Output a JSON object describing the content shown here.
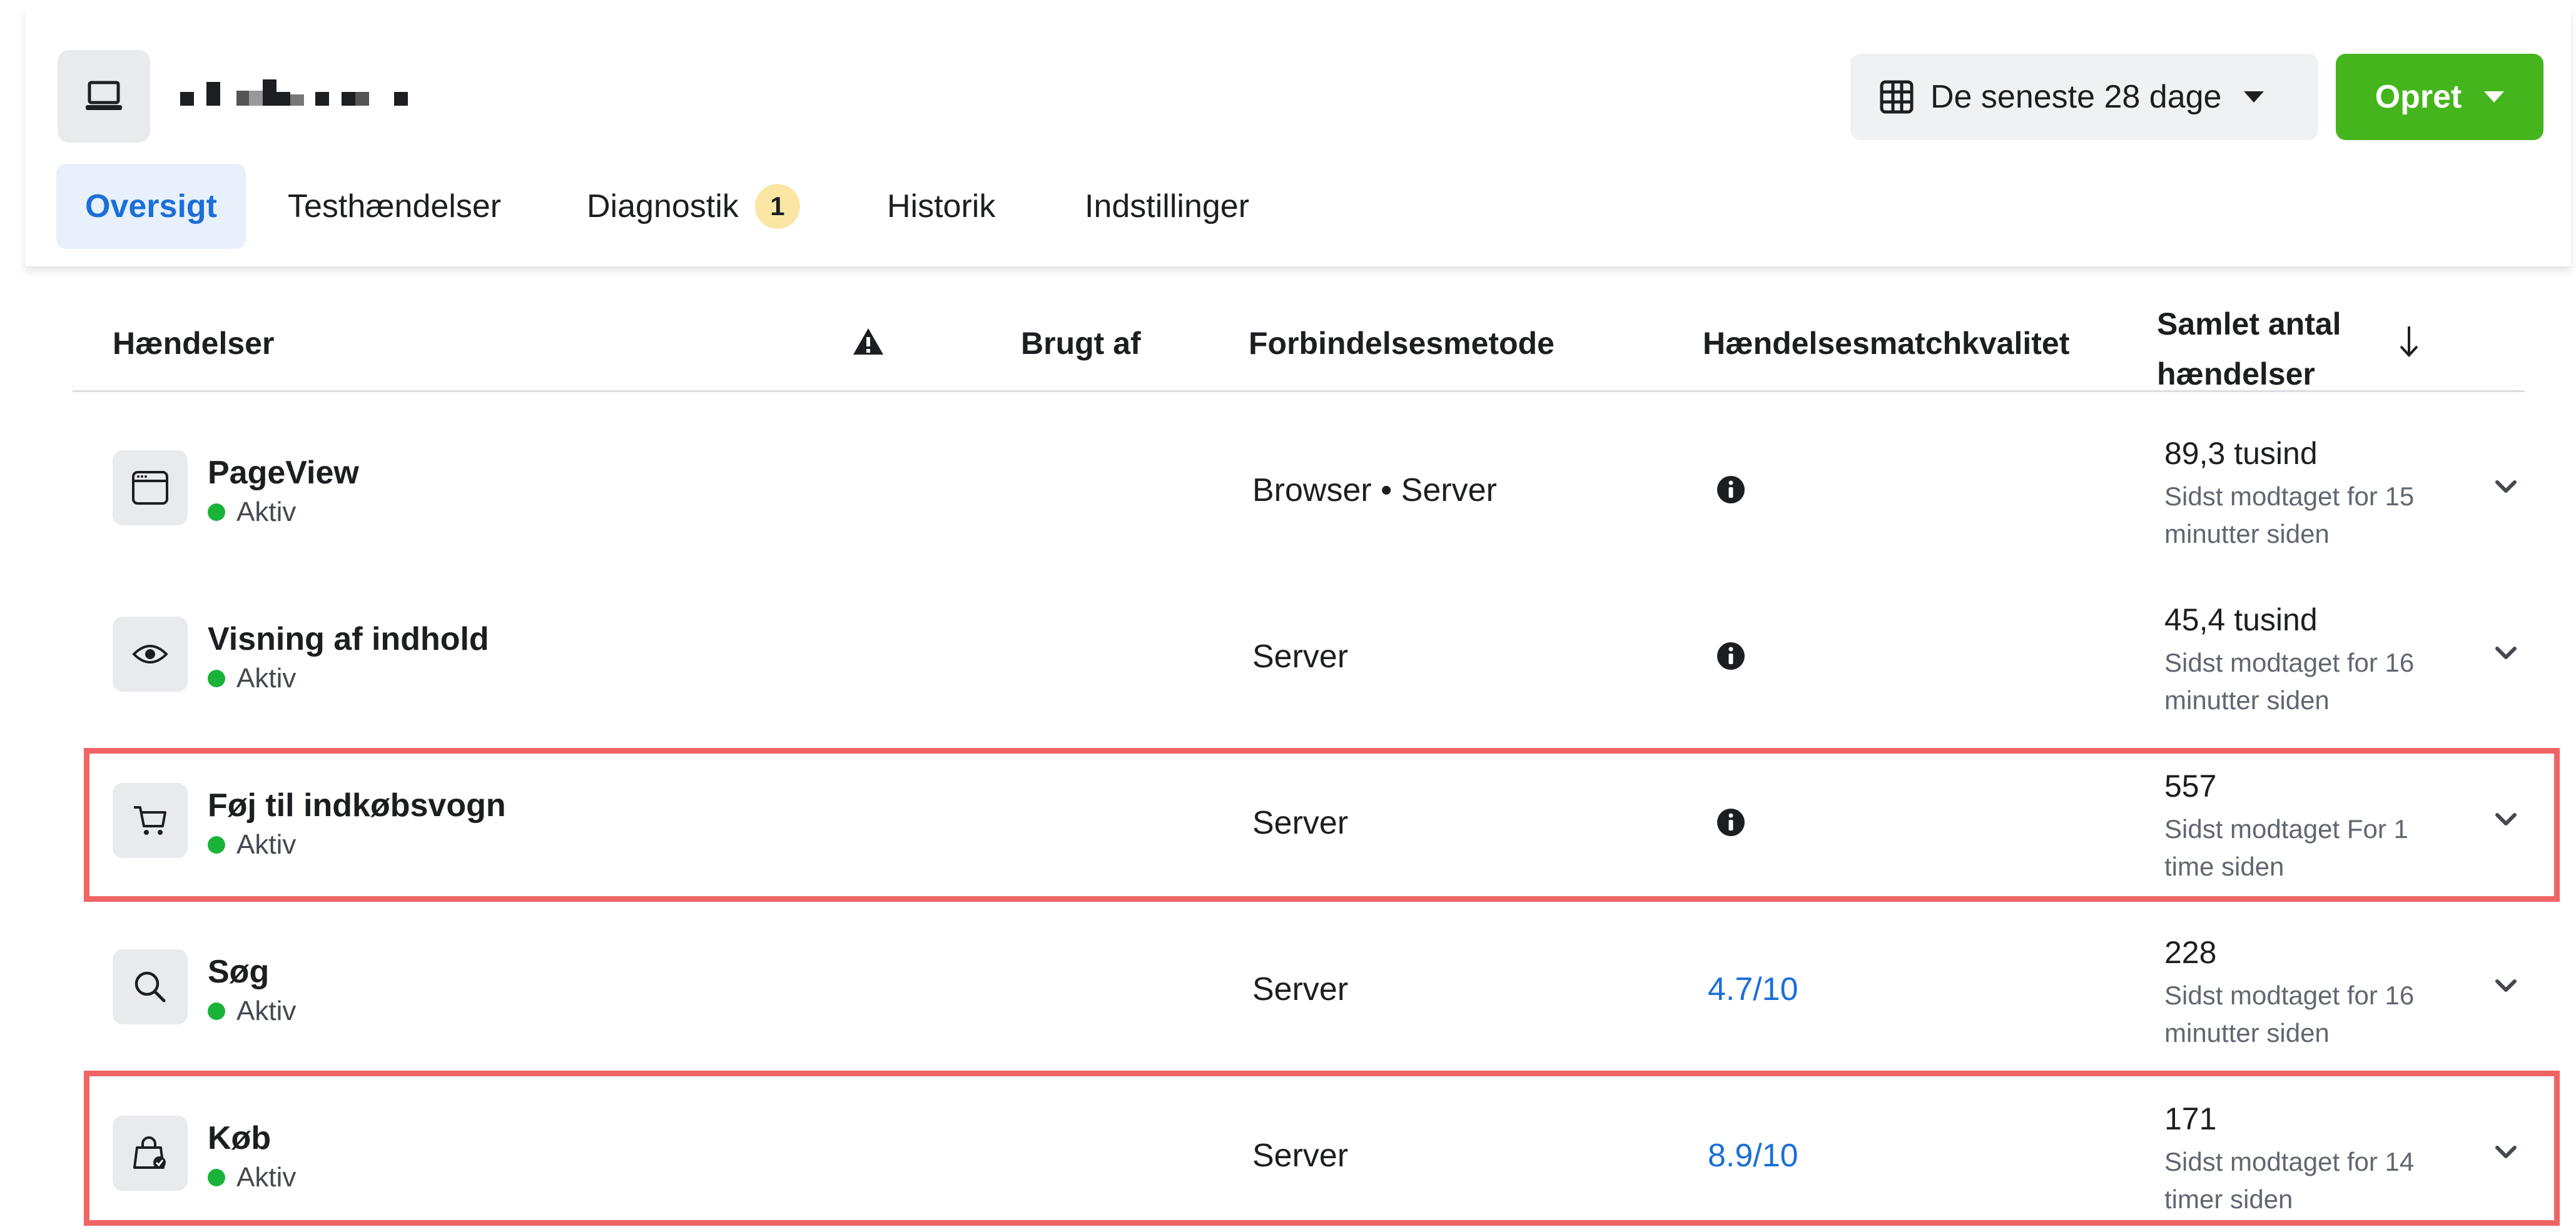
{
  "header": {
    "pixel_name_obscured": "",
    "date_range": "De seneste 28 dage",
    "create_label": "Opret"
  },
  "tabs": [
    {
      "label": "Oversigt",
      "active": true
    },
    {
      "label": "Testhændelser"
    },
    {
      "label": "Diagnostik",
      "badge": "1"
    },
    {
      "label": "Historik"
    },
    {
      "label": "Indstillinger"
    }
  ],
  "table": {
    "headers": {
      "events": "Hændelser",
      "used_by": "Brugt af",
      "connection": "Forbindelsesmetode",
      "match_quality": "Hændelsesmatchkvalitet",
      "total_line1": "Samlet antal",
      "total_line2": "hændelser"
    },
    "rows": [
      {
        "icon": "browser-window-icon",
        "name": "PageView",
        "status": "Aktiv",
        "method": "Browser • Server",
        "quality": "",
        "total": "89,3 tusind",
        "last": "Sidst modtaget for 15 minutter siden",
        "highlighted": false
      },
      {
        "icon": "eye-icon",
        "name": "Visning af indhold",
        "status": "Aktiv",
        "method": "Server",
        "quality": "",
        "total": "45,4 tusind",
        "last": "Sidst modtaget for 16 minutter siden",
        "highlighted": false
      },
      {
        "icon": "cart-icon",
        "name": "Føj til indkøbsvogn",
        "status": "Aktiv",
        "method": "Server",
        "quality": "",
        "total": "557",
        "last": "Sidst modtaget For 1 time siden",
        "highlighted": true
      },
      {
        "icon": "search-icon",
        "name": "Søg",
        "status": "Aktiv",
        "method": "Server",
        "quality": "4.7/10",
        "total": "228",
        "last": "Sidst modtaget for 16 minutter siden",
        "highlighted": false
      },
      {
        "icon": "shopping-bag-icon",
        "name": "Køb",
        "status": "Aktiv",
        "method": "Server",
        "quality": "8.9/10",
        "total": "171",
        "last": "Sidst modtaget for 14 timer siden",
        "highlighted": true
      }
    ]
  },
  "colors": {
    "accent_blue": "#1b6fd8",
    "create_green": "#44b51c",
    "active_dot": "#1ab33a",
    "highlight_red": "#f06464",
    "badge_yellow": "#fbe6a3"
  }
}
